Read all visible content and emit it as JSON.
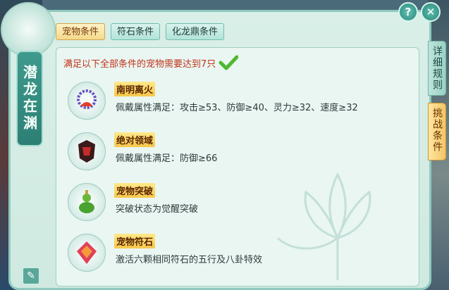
{
  "side_title": "潜龙在渊",
  "tabs": [
    "宠物条件",
    "符石条件",
    "化龙鼎条件"
  ],
  "heading": "满足以下全部条件的宠物需要达到7只",
  "conditions": [
    {
      "title": "南明离火",
      "desc": "佩戴属性满足：攻击≥53、防御≥40、灵力≥32、速度≥32",
      "icon": "fire-necklace-icon"
    },
    {
      "title": "绝对领域",
      "desc": "佩戴属性满足：防御≥66",
      "icon": "armor-icon"
    },
    {
      "title": "宠物突破",
      "desc": "突破状态为觉醒突破",
      "icon": "gourd-icon"
    },
    {
      "title": "宠物符石",
      "desc": "激活六颗相同符石的五行及八卦特效",
      "icon": "rune-stone-icon"
    }
  ],
  "right_tabs": [
    "详细规则",
    "挑战条件"
  ],
  "buttons": {
    "help": "?",
    "close": "✕"
  },
  "colors": {
    "accent": "#2d8a7c",
    "heading": "#c2331a",
    "active_tab": "#f3d98a"
  }
}
